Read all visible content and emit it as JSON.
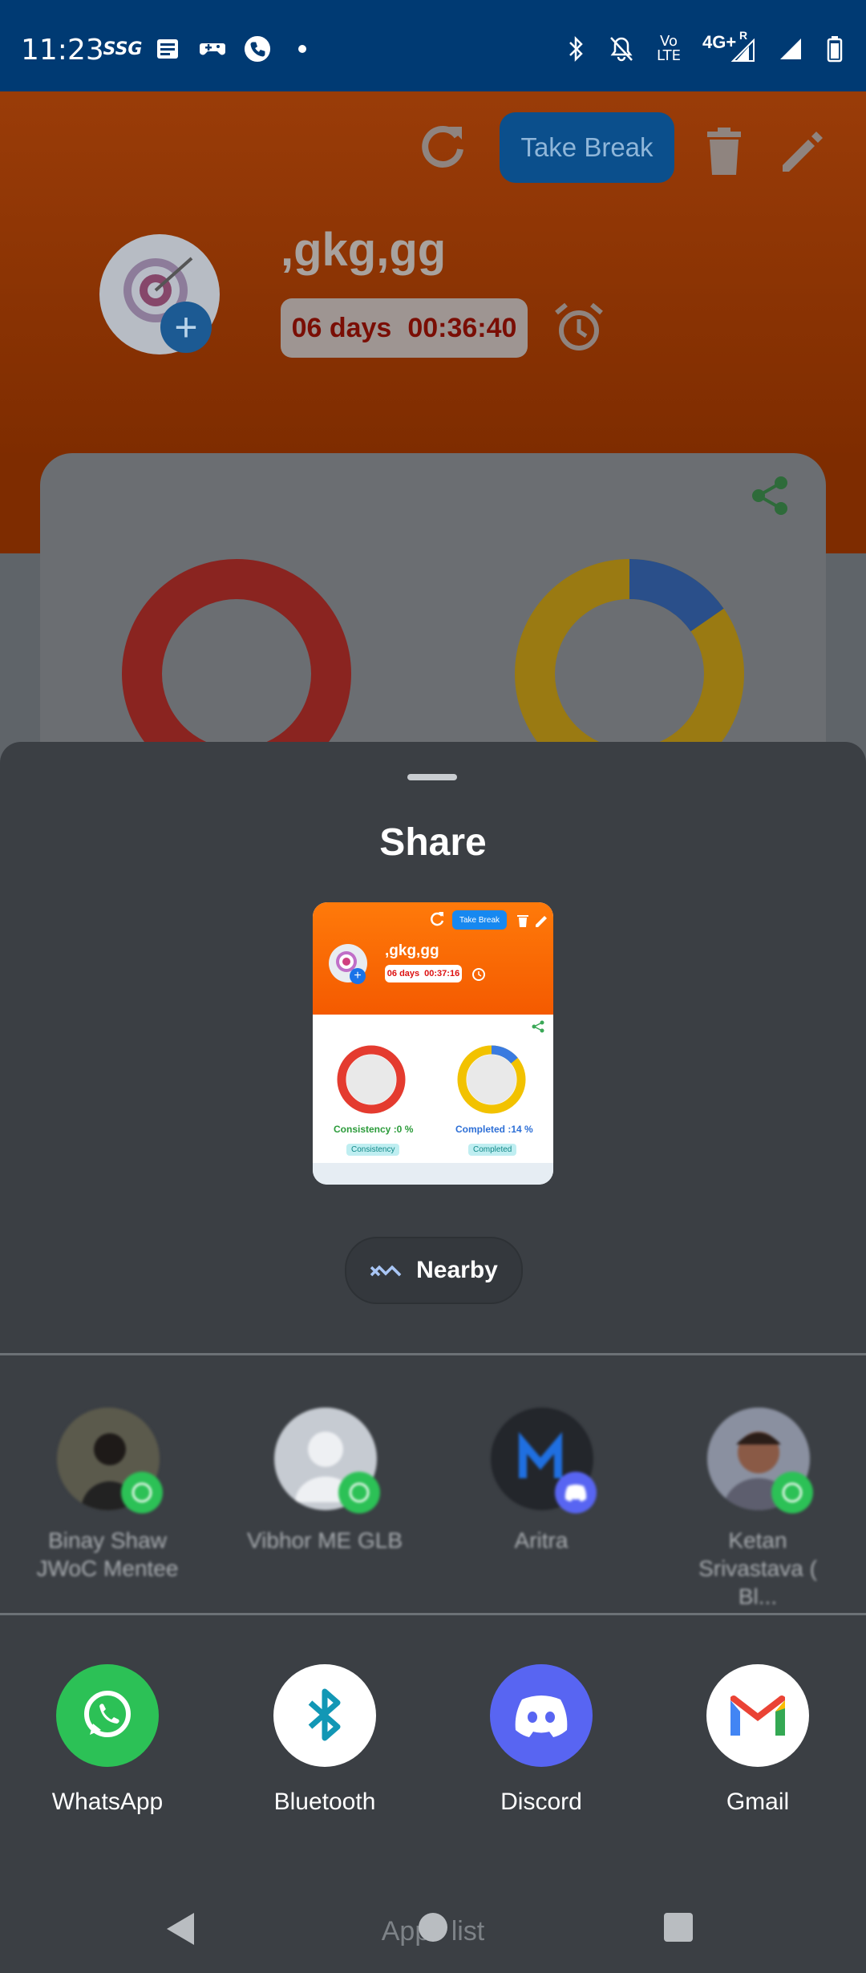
{
  "status_bar": {
    "time": "11:23",
    "left_icons": [
      "ssg-app-icon",
      "news-icon",
      "game-controller-icon",
      "phone-call-icon",
      "dot-icon"
    ],
    "ssg_text": "SSG",
    "volte_text": "Vo LTE",
    "network_text": "4G+",
    "roaming_text": "R"
  },
  "app": {
    "take_break": "Take Break",
    "goal_title": ",gkg,gg",
    "timer_days": "06 days",
    "timer_time": "00:36:40"
  },
  "share": {
    "title": "Share",
    "preview": {
      "take_break": "Take Break",
      "title": ",gkg,gg",
      "timer_days": "06 days",
      "timer_time": "00:37:16",
      "consistency_label": "Consistency :0 %",
      "consistency_chip": "Consistency",
      "completed_label": "Completed :14 %",
      "completed_chip": "Completed",
      "completed_fraction": 0.14
    },
    "nearby_label": "Nearby",
    "contacts": [
      {
        "name_line1": "Binay Shaw",
        "name_line2": "JWoC Mentee",
        "badge": "whatsapp-badge-icon"
      },
      {
        "name_line1": "Vibhor ME GLB",
        "name_line2": "",
        "badge": "whatsapp-badge-icon"
      },
      {
        "name_line1": "Aritra",
        "name_line2": "",
        "badge": "discord-badge-icon"
      },
      {
        "name_line1": "Ketan",
        "name_line2": "Srivastava ( Bl...",
        "badge": "whatsapp-badge-icon"
      }
    ],
    "apps": [
      {
        "label": "WhatsApp",
        "icon": "whatsapp-icon"
      },
      {
        "label": "Bluetooth",
        "icon": "bluetooth-icon"
      },
      {
        "label": "Discord",
        "icon": "discord-icon"
      },
      {
        "label": "Gmail",
        "icon": "gmail-icon"
      }
    ]
  },
  "nav": {
    "overlay_text": "Apps list"
  }
}
